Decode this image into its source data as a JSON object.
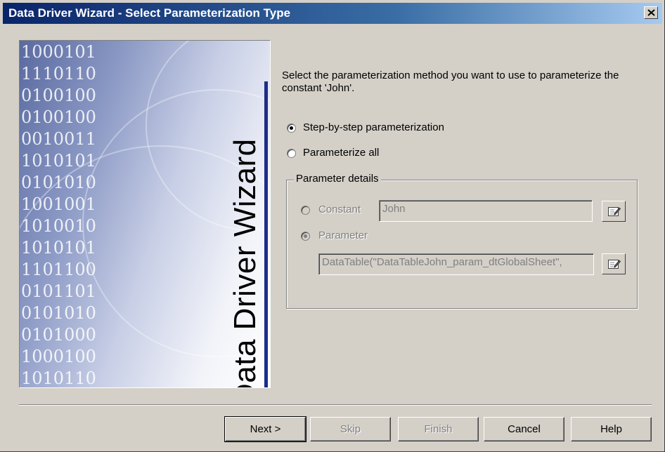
{
  "window": {
    "title": "Data Driver Wizard - Select Parameterization Type"
  },
  "side_panel": {
    "wizard_label": "Data Driver Wizard",
    "binary_lines": [
      "1000101",
      "1110110",
      "0100100",
      "0100100",
      "0010011",
      "1010101",
      "0101010",
      "1001001",
      "1010010",
      "1010101",
      "1101100",
      "0101101",
      "0101010",
      "0101000",
      "1000100",
      "1010110"
    ]
  },
  "instructions": "Select the parameterization method you want to use to parameterize the constant 'John'.",
  "options": {
    "step_by_step": {
      "label": "Step-by-step parameterization",
      "selected": true
    },
    "parameterize_all": {
      "label": "Parameterize all",
      "selected": false
    }
  },
  "parameter_details": {
    "legend": "Parameter details",
    "constant": {
      "label": "Constant",
      "value": "John",
      "selected": false,
      "enabled": false
    },
    "parameter": {
      "label": "Parameter",
      "value": "DataTable(\"DataTableJohn_param_dtGlobalSheet\",",
      "selected": true,
      "enabled": false
    }
  },
  "buttons": {
    "next": {
      "label": "Next >",
      "enabled": true
    },
    "skip": {
      "label": "Skip",
      "enabled": false
    },
    "finish": {
      "label": "Finish",
      "enabled": false
    },
    "cancel": {
      "label": "Cancel",
      "enabled": true
    },
    "help": {
      "label": "Help",
      "enabled": true
    }
  },
  "icons": [
    "close-icon",
    "edit-icon"
  ]
}
